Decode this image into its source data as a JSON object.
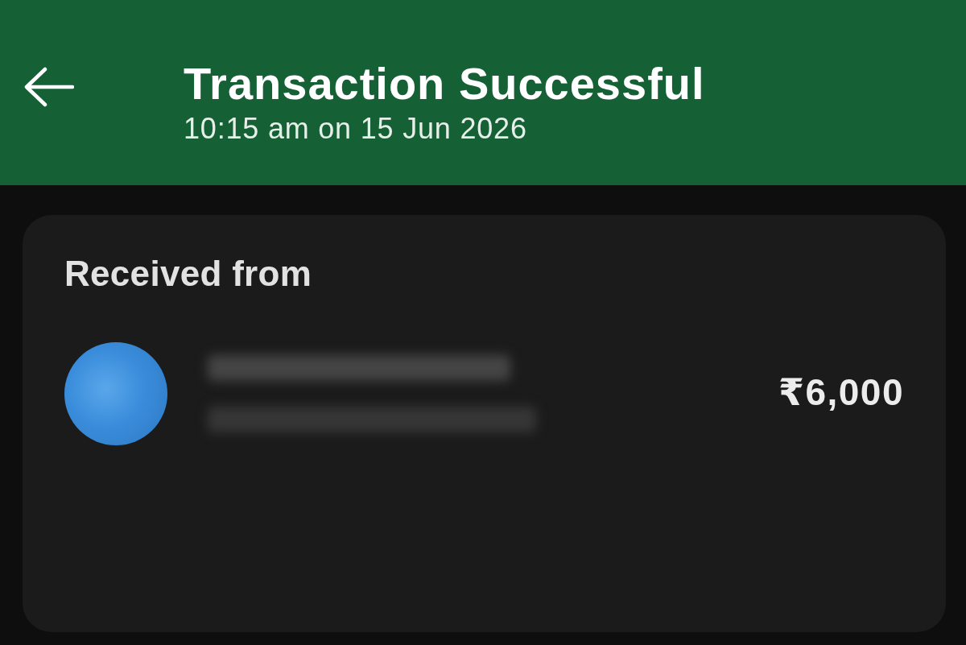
{
  "header": {
    "title": "Transaction Successful",
    "timestamp": "10:15 am on 15 Jun 2026"
  },
  "card": {
    "heading": "Received from",
    "amount": "₹6,000"
  }
}
